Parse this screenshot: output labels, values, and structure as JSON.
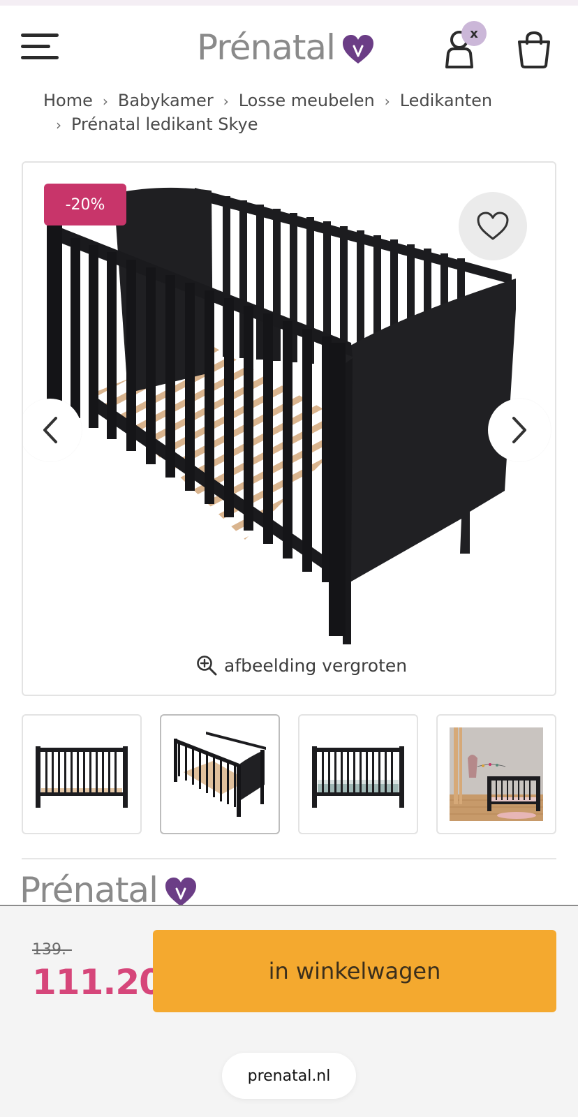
{
  "header": {
    "logo_text": "Prénatal",
    "account_badge": "x",
    "brand_color": "#6b3d86",
    "menu_icon": "hamburger-menu-icon",
    "account_icon": "user-icon",
    "cart_icon": "shopping-bag-icon"
  },
  "breadcrumb": {
    "items": [
      "Home",
      "Babykamer",
      "Losse meubelen",
      "Ledikanten",
      "Prénatal ledikant Skye"
    ],
    "separator": "›"
  },
  "product": {
    "discount_badge": "-20%",
    "zoom_label": "afbeelding vergroten",
    "thumbnail_count": 4,
    "active_thumbnail": 2
  },
  "brand_section": {
    "logo_text": "Prénatal"
  },
  "buy_bar": {
    "old_price": "139.-",
    "new_price": "111.20",
    "cart_button_label": "in winkelwagen",
    "price_color": "#d6467a",
    "button_color": "#f4a92f"
  },
  "browser": {
    "url": "prenatal.nl"
  }
}
